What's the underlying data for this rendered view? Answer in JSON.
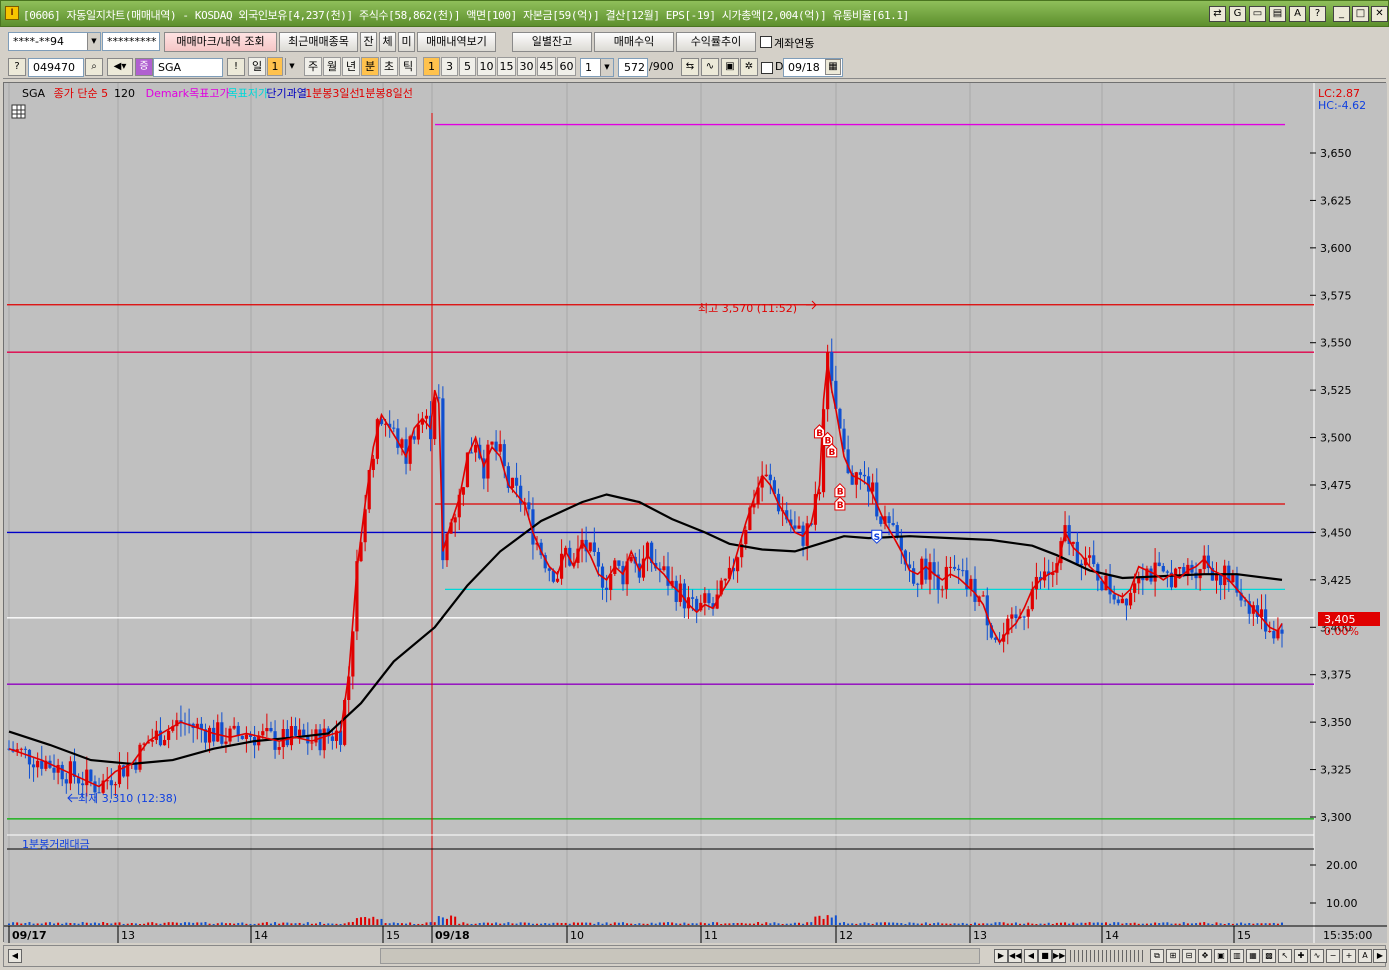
{
  "window": {
    "title": "[0606] 자동일지차트(매매내역) - KOSDAQ 외국인보유[4,237(천)] 주식수[58,862(천)] 액면[100] 자본금[59(억)] 결산[12월] EPS[-19] 시가총액[2,004(억)] 유통비율[61.1]"
  },
  "toolbar1": {
    "account": "****-**94",
    "password": "*********",
    "btn_mark": "매매마크/내역 조회",
    "btn_recent": "최근매매종목",
    "btn_jan": "잔",
    "btn_che": "체",
    "btn_mi": "미",
    "btn_history": "매매내역보기",
    "btn_daily_balance": "일별잔고",
    "btn_profit": "매매수익",
    "btn_return": "수익률추이",
    "link_account_label": "계좌연동"
  },
  "toolbar2": {
    "code": "049470",
    "name": "SGA",
    "period_tabs": [
      "일",
      "1",
      "주",
      "월",
      "년",
      "분",
      "초",
      "틱"
    ],
    "interval_tabs": [
      "1",
      "3",
      "5",
      "10",
      "15",
      "30",
      "45",
      "60"
    ],
    "multiplier": "1",
    "count": "572",
    "count_max": "/900",
    "d_label": "D",
    "date": "09/18"
  },
  "chart_data": {
    "type": "line",
    "legend": [
      {
        "label": "SGA",
        "color": "#000000"
      },
      {
        "label": "종가 단순 5",
        "color": "#e00000"
      },
      {
        "label": "120",
        "color": "#000000"
      },
      {
        "label": "Demark목표고가",
        "color": "#e000e0"
      },
      {
        "label": "목표저가",
        "color": "#00d8d8"
      },
      {
        "label": "단기과열",
        "color": "#0000c0"
      },
      {
        "label": "1분봉3일선",
        "color": "#e00000"
      },
      {
        "label": "1분봉8일선",
        "color": "#e00000"
      }
    ],
    "price_axis": {
      "ylim": [
        3290,
        3680
      ],
      "ticks": [
        "3,650",
        "3,625",
        "3,600",
        "3,575",
        "3,550",
        "3,525",
        "3,500",
        "3,475",
        "3,450",
        "3,425",
        "3,400",
        "3,375",
        "3,350",
        "3,325",
        "3,300"
      ]
    },
    "lc_label": "LC:2.87",
    "hc_label": "HC:-4.62",
    "current_price": "3,405",
    "current_change": "0.00%",
    "high_annotation": "최고 3,570 (11:52)",
    "low_annotation": "최저 3,310 (12:38)",
    "horizontal_lines": [
      {
        "name": "demark-target-high",
        "value": 3665,
        "color": "#e000e0"
      },
      {
        "name": "red-line-upper",
        "value": 3570,
        "color": "#e00000"
      },
      {
        "name": "crimson-line",
        "value": 3545,
        "color": "#e0004a"
      },
      {
        "name": "red-line-mid",
        "value": 3465,
        "color": "#e00000"
      },
      {
        "name": "blue-line",
        "value": 3450,
        "color": "#0000c8"
      },
      {
        "name": "cyan-line",
        "value": 3420,
        "color": "#00d8d8"
      },
      {
        "name": "white-line",
        "value": 3405,
        "color": "#ffffff"
      },
      {
        "name": "purple-line",
        "value": 3370,
        "color": "#9000c0"
      },
      {
        "name": "green-line",
        "value": 3299,
        "color": "#00b000"
      }
    ],
    "time_axis": [
      "09/17",
      "13",
      "14",
      "15",
      "09/18",
      "10",
      "11",
      "12",
      "13",
      "14",
      "15"
    ],
    "time_readout": "15:35:00",
    "ma5": [
      [
        0,
        3336
      ],
      [
        8,
        3330
      ],
      [
        16,
        3322
      ],
      [
        22,
        3316
      ],
      [
        26,
        3324
      ],
      [
        30,
        3328
      ],
      [
        34,
        3340
      ],
      [
        38,
        3345
      ],
      [
        42,
        3350
      ],
      [
        46,
        3347
      ],
      [
        50,
        3344
      ],
      [
        54,
        3342
      ],
      [
        58,
        3344
      ],
      [
        62,
        3342
      ],
      [
        66,
        3340
      ],
      [
        70,
        3342
      ],
      [
        74,
        3340
      ],
      [
        78,
        3343
      ],
      [
        81,
        3345
      ],
      [
        83,
        3375
      ],
      [
        85,
        3430
      ],
      [
        87,
        3465
      ],
      [
        89,
        3495
      ],
      [
        91,
        3512
      ],
      [
        93,
        3505
      ],
      [
        95,
        3498
      ],
      [
        97,
        3490
      ],
      [
        99,
        3505
      ],
      [
        101,
        3510
      ],
      [
        103,
        3505
      ],
      [
        104,
        3525
      ],
      [
        105,
        3518
      ],
      [
        106,
        3440
      ],
      [
        108,
        3455
      ],
      [
        110,
        3468
      ],
      [
        112,
        3490
      ],
      [
        114,
        3500
      ],
      [
        116,
        3485
      ],
      [
        118,
        3495
      ],
      [
        120,
        3490
      ],
      [
        122,
        3475
      ],
      [
        124,
        3470
      ],
      [
        126,
        3465
      ],
      [
        128,
        3450
      ],
      [
        130,
        3440
      ],
      [
        132,
        3432
      ],
      [
        134,
        3428
      ],
      [
        136,
        3440
      ],
      [
        138,
        3432
      ],
      [
        140,
        3445
      ],
      [
        142,
        3438
      ],
      [
        144,
        3428
      ],
      [
        146,
        3425
      ],
      [
        148,
        3432
      ],
      [
        150,
        3428
      ],
      [
        152,
        3440
      ],
      [
        154,
        3430
      ],
      [
        156,
        3438
      ],
      [
        158,
        3432
      ],
      [
        160,
        3428
      ],
      [
        162,
        3422
      ],
      [
        164,
        3418
      ],
      [
        166,
        3412
      ],
      [
        168,
        3408
      ],
      [
        170,
        3412
      ],
      [
        172,
        3410
      ],
      [
        174,
        3418
      ],
      [
        176,
        3425
      ],
      [
        178,
        3440
      ],
      [
        180,
        3455
      ],
      [
        182,
        3468
      ],
      [
        184,
        3480
      ],
      [
        186,
        3475
      ],
      [
        188,
        3465
      ],
      [
        190,
        3458
      ],
      [
        192,
        3450
      ],
      [
        194,
        3448
      ],
      [
        196,
        3455
      ],
      [
        198,
        3475
      ],
      [
        199,
        3520
      ],
      [
        200,
        3540
      ],
      [
        201,
        3525
      ],
      [
        202,
        3515
      ],
      [
        204,
        3490
      ],
      [
        206,
        3480
      ],
      [
        208,
        3478
      ],
      [
        210,
        3475
      ],
      [
        212,
        3465
      ],
      [
        214,
        3455
      ],
      [
        216,
        3448
      ],
      [
        218,
        3440
      ],
      [
        220,
        3430
      ],
      [
        222,
        3428
      ],
      [
        224,
        3432
      ],
      [
        226,
        3428
      ],
      [
        228,
        3425
      ],
      [
        230,
        3428
      ],
      [
        232,
        3426
      ],
      [
        234,
        3422
      ],
      [
        236,
        3418
      ],
      [
        238,
        3412
      ],
      [
        240,
        3400
      ],
      [
        242,
        3392
      ],
      [
        244,
        3398
      ],
      [
        246,
        3402
      ],
      [
        248,
        3410
      ],
      [
        250,
        3420
      ],
      [
        252,
        3425
      ],
      [
        254,
        3428
      ],
      [
        256,
        3430
      ],
      [
        258,
        3450
      ],
      [
        260,
        3442
      ],
      [
        262,
        3438
      ],
      [
        264,
        3432
      ],
      [
        266,
        3428
      ],
      [
        268,
        3422
      ],
      [
        270,
        3418
      ],
      [
        272,
        3416
      ],
      [
        274,
        3420
      ],
      [
        276,
        3432
      ],
      [
        278,
        3430
      ],
      [
        280,
        3428
      ],
      [
        282,
        3425
      ],
      [
        284,
        3428
      ],
      [
        286,
        3426
      ],
      [
        288,
        3430
      ],
      [
        290,
        3432
      ],
      [
        292,
        3436
      ],
      [
        294,
        3430
      ],
      [
        296,
        3428
      ],
      [
        298,
        3425
      ],
      [
        300,
        3420
      ],
      [
        302,
        3415
      ],
      [
        304,
        3410
      ],
      [
        306,
        3405
      ],
      [
        308,
        3400
      ],
      [
        310,
        3398
      ],
      [
        311,
        3402
      ]
    ],
    "ma120": [
      [
        0,
        3345
      ],
      [
        10,
        3338
      ],
      [
        20,
        3330
      ],
      [
        30,
        3328
      ],
      [
        40,
        3330
      ],
      [
        50,
        3336
      ],
      [
        60,
        3340
      ],
      [
        70,
        3342
      ],
      [
        78,
        3344
      ],
      [
        86,
        3360
      ],
      [
        94,
        3382
      ],
      [
        104,
        3400
      ],
      [
        112,
        3422
      ],
      [
        120,
        3440
      ],
      [
        130,
        3456
      ],
      [
        140,
        3466
      ],
      [
        146,
        3470
      ],
      [
        154,
        3466
      ],
      [
        162,
        3457
      ],
      [
        170,
        3450
      ],
      [
        176,
        3444
      ],
      [
        184,
        3441
      ],
      [
        192,
        3440
      ],
      [
        198,
        3444
      ],
      [
        204,
        3448
      ],
      [
        210,
        3447
      ],
      [
        220,
        3448
      ],
      [
        230,
        3447
      ],
      [
        240,
        3446
      ],
      [
        250,
        3443
      ],
      [
        256,
        3438
      ],
      [
        264,
        3430
      ],
      [
        272,
        3426
      ],
      [
        282,
        3427
      ],
      [
        292,
        3428
      ],
      [
        300,
        3428
      ],
      [
        311,
        3425
      ]
    ],
    "trade_marks": [
      {
        "x": 198,
        "y": 3503,
        "label": "B"
      },
      {
        "x": 200,
        "y": 3499,
        "label": "B"
      },
      {
        "x": 201,
        "y": 3493,
        "label": "B"
      },
      {
        "x": 203,
        "y": 3472,
        "label": "B"
      },
      {
        "x": 203,
        "y": 3465,
        "label": "B"
      },
      {
        "x": 212,
        "y": 3448,
        "label": "S"
      }
    ],
    "volume_panel": {
      "label": "1분봉거래대금",
      "ticks": [
        "20.00",
        "10.00"
      ]
    }
  },
  "colors": {
    "chart_bg": "#c0c0c0",
    "up": "#e00000",
    "down": "#1050d0",
    "title_bar": "#6ea03c"
  }
}
